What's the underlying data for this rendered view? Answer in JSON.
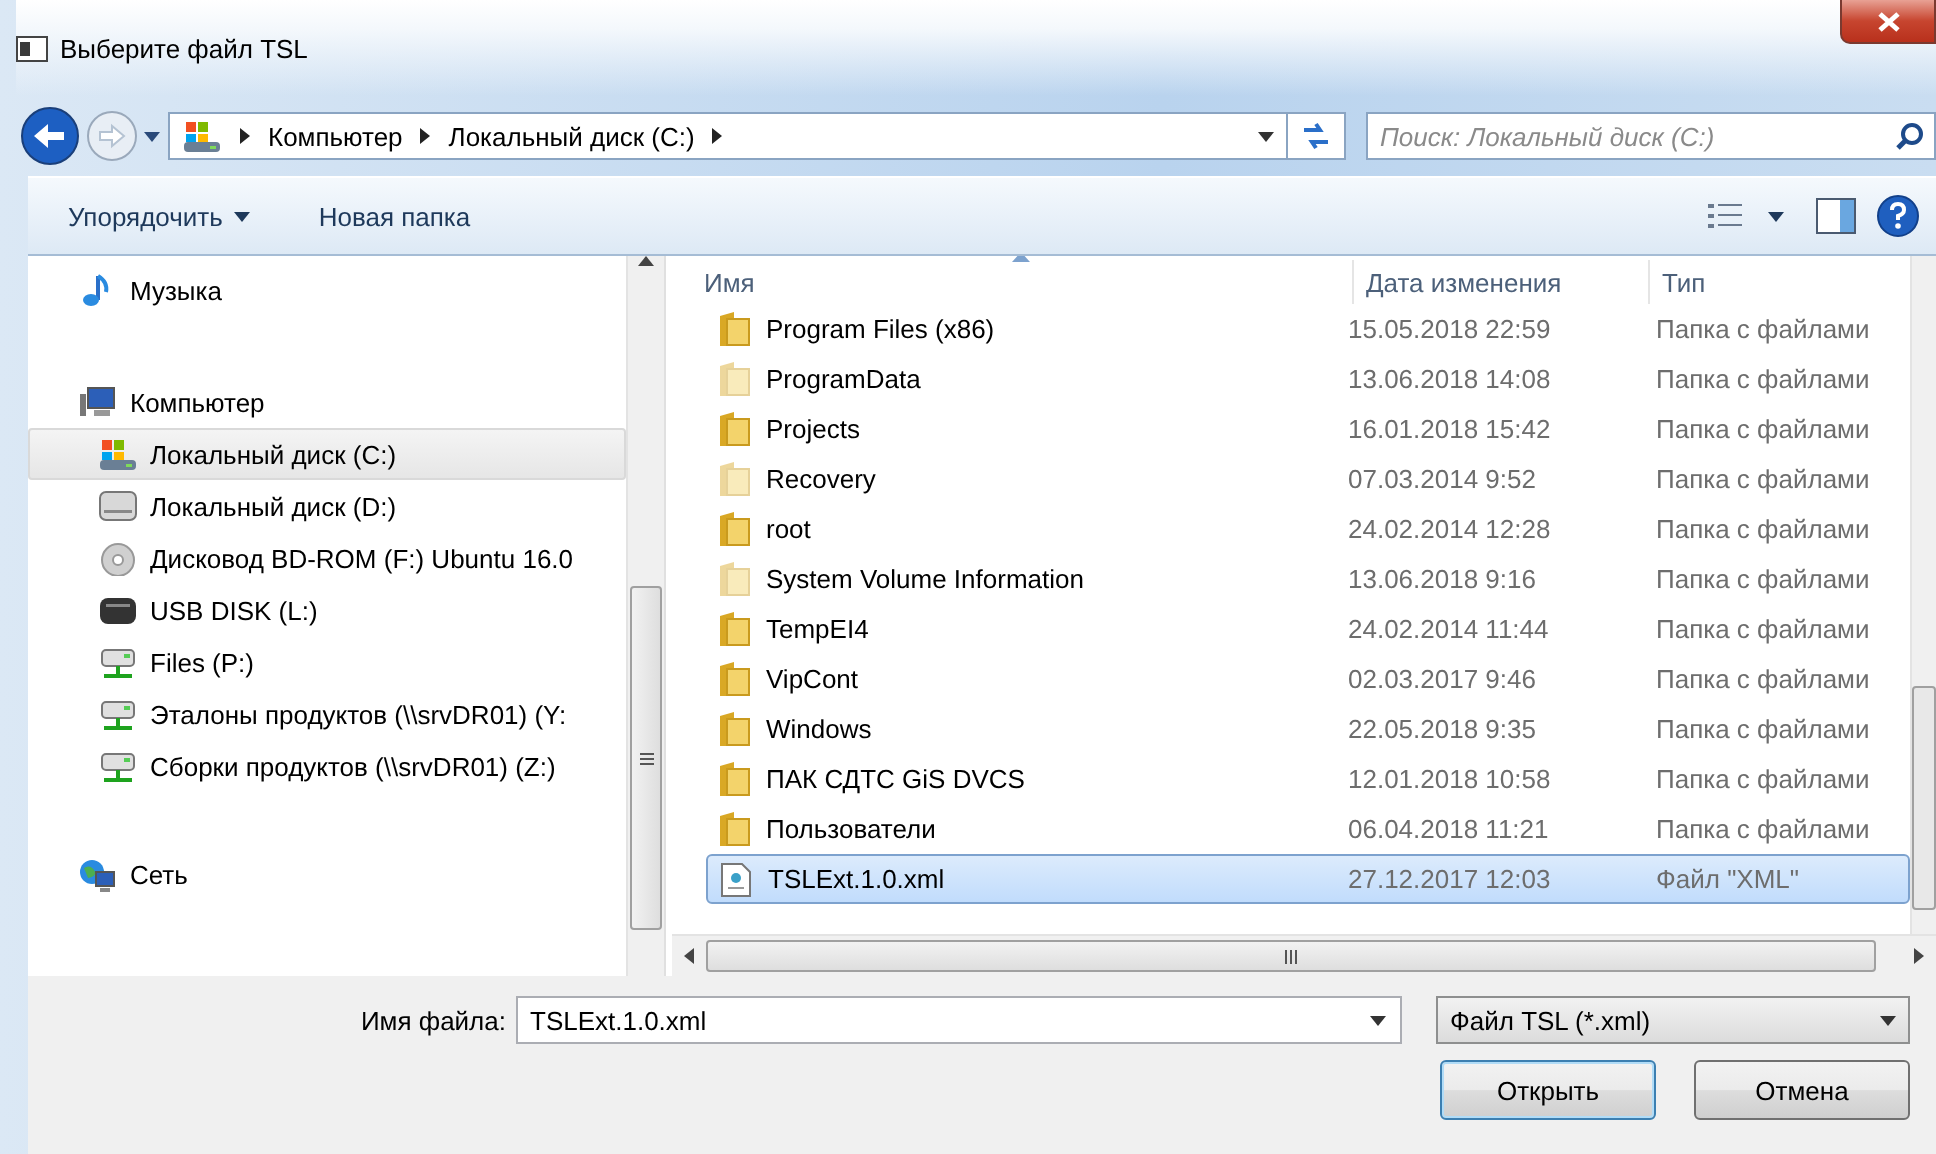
{
  "window": {
    "title": "Выберите файл TSL"
  },
  "address_bar": {
    "path": [
      "Компьютер",
      "Локальный диск (C:)"
    ]
  },
  "search": {
    "placeholder": "Поиск: Локальный диск (C:)"
  },
  "toolbar": {
    "buttons": [
      {
        "label": "Упорядочить",
        "dropdown": true
      },
      {
        "label": "Новая папка",
        "dropdown": false
      }
    ]
  },
  "navigation": {
    "items": [
      {
        "label": "Музыка",
        "kind": "music",
        "selected": false
      },
      {
        "label": "Компьютер",
        "kind": "computer",
        "selected": false,
        "children": [
          {
            "label": "Локальный диск (C:)",
            "kind": "system-drive",
            "selected": true
          },
          {
            "label": "Локальный диск (D:)",
            "kind": "drive",
            "selected": false
          },
          {
            "label": "Дисковод BD-ROM (F:) Ubuntu 16.0",
            "kind": "disc",
            "selected": false
          },
          {
            "label": "USB DISK (L:)",
            "kind": "usb",
            "selected": false
          },
          {
            "label": "Files (P:)",
            "kind": "network-drive",
            "selected": false
          },
          {
            "label": "Эталоны продуктов (\\\\srvDR01) (Y:",
            "kind": "network-drive",
            "selected": false
          },
          {
            "label": "Сборки продуктов (\\\\srvDR01) (Z:)",
            "kind": "network-drive",
            "selected": false
          }
        ]
      },
      {
        "label": "Сеть",
        "kind": "network",
        "selected": false
      }
    ]
  },
  "file_list": {
    "columns": [
      {
        "label": "Имя",
        "sorted": true
      },
      {
        "label": "Дата изменения",
        "sorted": false
      },
      {
        "label": "Тип",
        "sorted": false
      }
    ],
    "rows": [
      {
        "name": "Program Files (x86)",
        "date": "15.05.2018 22:59",
        "type": "Папка с файлами",
        "kind": "folder",
        "hidden": false,
        "selected": false
      },
      {
        "name": "ProgramData",
        "date": "13.06.2018 14:08",
        "type": "Папка с файлами",
        "kind": "folder",
        "hidden": true,
        "selected": false
      },
      {
        "name": "Projects",
        "date": "16.01.2018 15:42",
        "type": "Папка с файлами",
        "kind": "folder",
        "hidden": false,
        "selected": false
      },
      {
        "name": "Recovery",
        "date": "07.03.2014 9:52",
        "type": "Папка с файлами",
        "kind": "folder",
        "hidden": true,
        "selected": false
      },
      {
        "name": "root",
        "date": "24.02.2014 12:28",
        "type": "Папка с файлами",
        "kind": "folder",
        "hidden": false,
        "selected": false
      },
      {
        "name": "System Volume Information",
        "date": "13.06.2018 9:16",
        "type": "Папка с файлами",
        "kind": "folder",
        "hidden": true,
        "selected": false
      },
      {
        "name": "TempEI4",
        "date": "24.02.2014 11:44",
        "type": "Папка с файлами",
        "kind": "folder",
        "hidden": false,
        "selected": false
      },
      {
        "name": "VipCont",
        "date": "02.03.2017 9:46",
        "type": "Папка с файлами",
        "kind": "folder",
        "hidden": false,
        "selected": false
      },
      {
        "name": "Windows",
        "date": "22.05.2018 9:35",
        "type": "Папка с файлами",
        "kind": "folder",
        "hidden": false,
        "selected": false
      },
      {
        "name": "ПАК СДТС GiS DVCS",
        "date": "12.01.2018 10:58",
        "type": "Папка с файлами",
        "kind": "folder",
        "hidden": false,
        "selected": false
      },
      {
        "name": "Пользователи",
        "date": "06.04.2018 11:21",
        "type": "Папка с файлами",
        "kind": "folder",
        "hidden": false,
        "selected": false
      },
      {
        "name": "TSLExt.1.0.xml",
        "date": "27.12.2017 12:03",
        "type": "Файл \"XML\"",
        "kind": "xml",
        "hidden": false,
        "selected": true
      }
    ]
  },
  "file_name": {
    "label": "Имя файла:",
    "value": "TSLExt.1.0.xml"
  },
  "file_type": {
    "value": "Файл TSL (*.xml)"
  },
  "buttons": [
    {
      "label": "Открыть",
      "default": true
    },
    {
      "label": "Отмена",
      "default": false
    }
  ]
}
